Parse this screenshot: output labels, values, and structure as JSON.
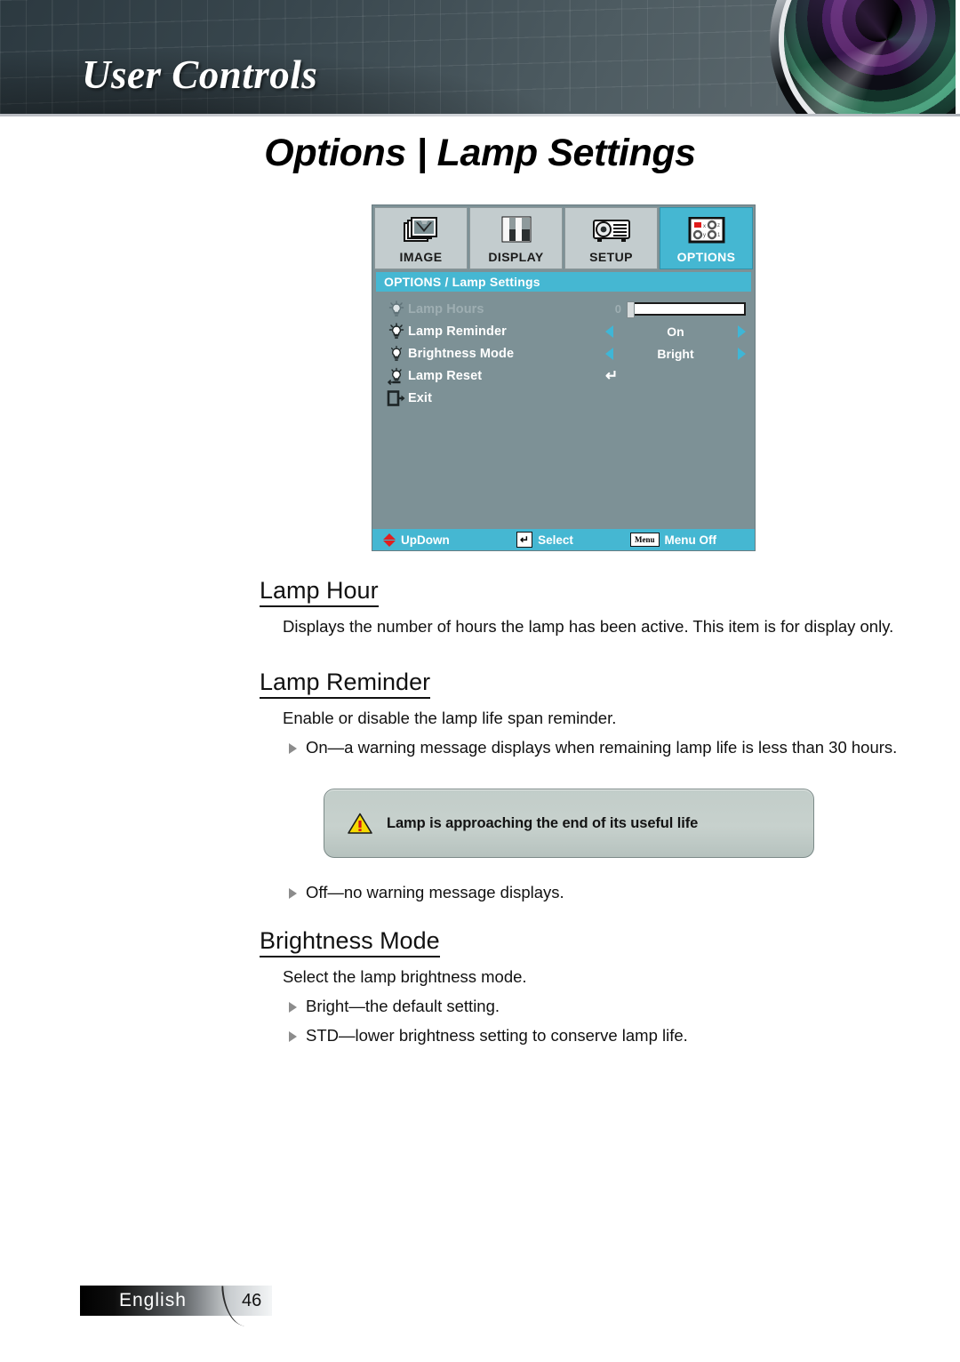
{
  "banner": {
    "title": "User Controls"
  },
  "page": {
    "title": "Options | Lamp Settings"
  },
  "osd": {
    "tabs": [
      {
        "label": "IMAGE",
        "icon": "image-icon",
        "active": false
      },
      {
        "label": "DISPLAY",
        "icon": "display-icon",
        "active": false
      },
      {
        "label": "SETUP",
        "icon": "projector-icon",
        "active": false
      },
      {
        "label": "OPTIONS",
        "icon": "options-icon",
        "active": true
      }
    ],
    "subtitle": "OPTIONS / Lamp Settings",
    "rows": [
      {
        "label": "Lamp Hours",
        "icon": "lamp-icon",
        "control": "slider",
        "value": "0",
        "disabled": true
      },
      {
        "label": "Lamp Reminder",
        "icon": "lamp-icon",
        "control": "spinner",
        "value": "On",
        "disabled": false
      },
      {
        "label": "Brightness Mode",
        "icon": "bulb-icon",
        "control": "spinner",
        "value": "Bright",
        "disabled": false
      },
      {
        "label": "Lamp Reset",
        "icon": "lamp-reset-icon",
        "control": "enter",
        "value": "",
        "disabled": false
      },
      {
        "label": "Exit",
        "icon": "exit-icon",
        "control": "none",
        "value": "",
        "disabled": false
      }
    ],
    "footer": [
      {
        "key": "updown-arrows-icon",
        "label": "UpDown"
      },
      {
        "key": "enter-key-icon",
        "label": "Select"
      },
      {
        "key": "menu-key-icon",
        "label": "Menu Off",
        "key_text": "Menu"
      }
    ],
    "colors": {
      "accent": "#45b7d2",
      "body": "#7d9196",
      "tab": "#c3ccce",
      "disabled_text": "#9eaeb2"
    }
  },
  "sections": [
    {
      "heading": "Lamp Hour",
      "paragraphs": [
        "Displays the number of hours the lamp has been active. This item is for display only."
      ],
      "bullets": []
    },
    {
      "heading": "Lamp Reminder",
      "paragraphs": [
        "Enable or disable the lamp life span reminder."
      ],
      "bullets": [
        "On—a warning message displays when remaining lamp life is less than 30 hours.",
        "Off—no warning message displays."
      ]
    },
    {
      "heading": "Brightness Mode",
      "paragraphs": [
        "Select the lamp brightness mode."
      ],
      "bullets": [
        "Bright—the default setting.",
        "STD—lower brightness setting to conserve lamp life."
      ]
    }
  ],
  "warning_dialog": {
    "icon": "warning-triangle-icon",
    "message": "Lamp is approaching the end of its useful life"
  },
  "footer": {
    "language": "English",
    "page_number": "46"
  }
}
